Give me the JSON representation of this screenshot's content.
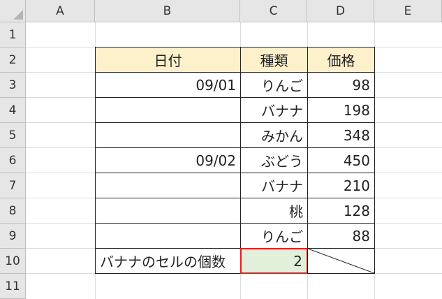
{
  "columns": [
    "A",
    "B",
    "C",
    "D",
    "E"
  ],
  "rows": [
    "1",
    "2",
    "3",
    "4",
    "5",
    "6",
    "7",
    "8",
    "9",
    "10",
    "11"
  ],
  "table": {
    "headers": {
      "date": "日付",
      "type": "種類",
      "price": "価格"
    },
    "records": [
      {
        "date": "09/01",
        "type": "りんご",
        "price": "98"
      },
      {
        "date": "",
        "type": "バナナ",
        "price": "198"
      },
      {
        "date": "",
        "type": "みかん",
        "price": "348"
      },
      {
        "date": "09/02",
        "type": "ぶどう",
        "price": "450"
      },
      {
        "date": "",
        "type": "バナナ",
        "price": "210"
      },
      {
        "date": "",
        "type": "桃",
        "price": "128"
      },
      {
        "date": "",
        "type": "りんご",
        "price": "88"
      }
    ],
    "summary": {
      "label": "バナナのセルの個数",
      "value": "2"
    }
  },
  "colors": {
    "header_fill": "#fdf1cc",
    "selected_fill": "#e2efda",
    "selected_border": "#e02020"
  }
}
